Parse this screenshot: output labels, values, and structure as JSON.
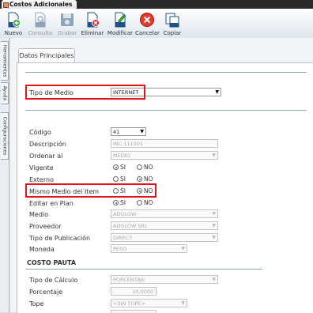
{
  "window": {
    "title": "Costos Adicionales"
  },
  "toolbar": {
    "nuevo": "Nuevo",
    "consulta": "Consulta",
    "grabar": "Grabar",
    "eliminar": "Eliminar",
    "modificar": "Modificar",
    "cancelar": "Cancelar",
    "copiar": "Copiar"
  },
  "side_tabs": [
    "Herramientas",
    "Ayuda",
    "Configuraciones"
  ],
  "tab": {
    "label": "Datos Principales"
  },
  "form": {
    "tipo_medio": {
      "label": "Tipo de Medio",
      "value": "INTERNET"
    },
    "codigo": {
      "label": "Código",
      "value": "41"
    },
    "descripcion": {
      "label": "Descripción",
      "value": "INC 111001"
    },
    "ordenar_al": {
      "label": "Ordenar al",
      "value": "MEDIO"
    },
    "vigente": {
      "label": "Vigente",
      "si": "SI",
      "no": "NO",
      "selected": "SI"
    },
    "externo": {
      "label": "Externo",
      "si": "SI",
      "no": "NO",
      "selected": "NO"
    },
    "mismo_medio": {
      "label": "Mismo Medio del Item",
      "si": "SI",
      "no": "NO",
      "selected": "NO"
    },
    "editar_en_plan": {
      "label": "Editar en Plan",
      "si": "SI",
      "no": "NO",
      "selected": "SI"
    },
    "medio": {
      "label": "Medio",
      "value": "ADGLOW"
    },
    "proveedor": {
      "label": "Proveedor",
      "value": "ADGLOW SRL"
    },
    "tipo_publicacion": {
      "label": "Tipo de Publicación",
      "value": "DIRECT"
    },
    "moneda": {
      "label": "Moneda",
      "value": "PESO"
    }
  },
  "costo_pauta": {
    "title": "COSTO PAUTA",
    "tipo_calculo": {
      "label": "Tipo de Cálculo",
      "value": "PORCENTAJE"
    },
    "porcentaje": {
      "label": "Porcentaje",
      "value": "10,0000"
    },
    "tope": {
      "label": "Tope",
      "value": "<SIN TOPE>"
    }
  },
  "colors": {
    "highlight": "#e0141b",
    "accent": "#2a6cc2",
    "radio_on": "#2a8a2a"
  }
}
